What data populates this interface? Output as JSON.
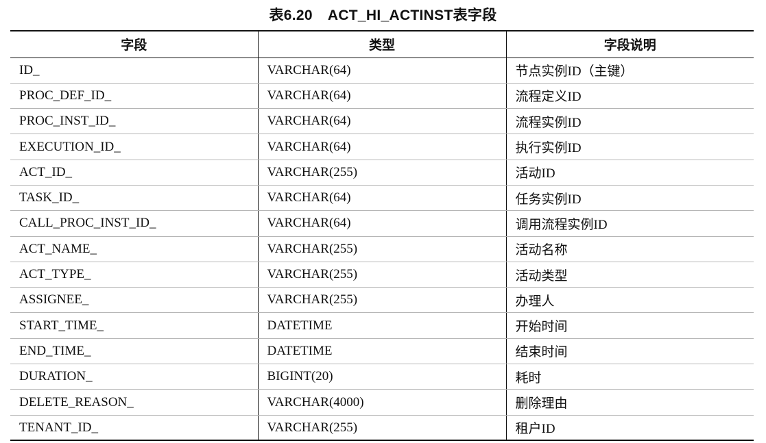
{
  "caption": {
    "number": "表6.20",
    "title": "ACT_HI_ACTINST表字段"
  },
  "table": {
    "headers": [
      "字段",
      "类型",
      "字段说明"
    ],
    "rows": [
      [
        "ID_",
        "VARCHAR(64)",
        "节点实例ID（主键）"
      ],
      [
        "PROC_DEF_ID_",
        "VARCHAR(64)",
        "流程定义ID"
      ],
      [
        "PROC_INST_ID_",
        "VARCHAR(64)",
        "流程实例ID"
      ],
      [
        "EXECUTION_ID_",
        "VARCHAR(64)",
        "执行实例ID"
      ],
      [
        "ACT_ID_",
        "VARCHAR(255)",
        "活动ID"
      ],
      [
        "TASK_ID_",
        "VARCHAR(64)",
        "任务实例ID"
      ],
      [
        "CALL_PROC_INST_ID_",
        "VARCHAR(64)",
        "调用流程实例ID"
      ],
      [
        "ACT_NAME_",
        "VARCHAR(255)",
        "活动名称"
      ],
      [
        "ACT_TYPE_",
        "VARCHAR(255)",
        "活动类型"
      ],
      [
        "ASSIGNEE_",
        "VARCHAR(255)",
        "办理人"
      ],
      [
        "START_TIME_",
        "DATETIME",
        "开始时间"
      ],
      [
        "END_TIME_",
        "DATETIME",
        "结束时间"
      ],
      [
        "DURATION_",
        "BIGINT(20)",
        "耗时"
      ],
      [
        "DELETE_REASON_",
        "VARCHAR(4000)",
        "删除理由"
      ],
      [
        "TENANT_ID_",
        "VARCHAR(255)",
        "租户ID"
      ]
    ]
  }
}
